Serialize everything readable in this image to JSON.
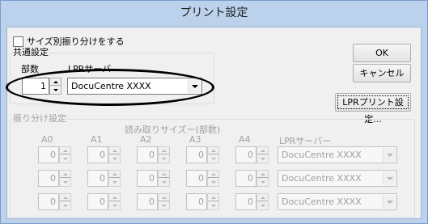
{
  "window": {
    "title": "プリント設定"
  },
  "split_checkbox": {
    "label": "サイズ別振り分けをする",
    "checked": false
  },
  "common": {
    "group_label": "共通設定",
    "copies_label": "部数",
    "printer_label": "LPRサーバ",
    "copies_value": "1",
    "printer_value": "DocuCentre XXXX"
  },
  "buttons": {
    "ok": "OK",
    "cancel": "キャンセル",
    "lpr_print_settings": "LPRプリント設定..."
  },
  "distribution": {
    "group_label": "振り分け設定",
    "size_header": "読み取りサイズー(部数)",
    "columns": [
      "A0",
      "A1",
      "A2",
      "A3",
      "A4"
    ],
    "server_header": "LPRサーバー",
    "rows": [
      {
        "values": [
          "0",
          "0",
          "0",
          "0",
          "0"
        ],
        "server": "DocuCentre XXXX"
      },
      {
        "values": [
          "0",
          "0",
          "0",
          "0",
          "0"
        ],
        "server": "DocuCentre XXXX"
      },
      {
        "values": [
          "0",
          "0",
          "0",
          "0",
          "0"
        ],
        "server": "DocuCentre XXXX"
      }
    ]
  }
}
